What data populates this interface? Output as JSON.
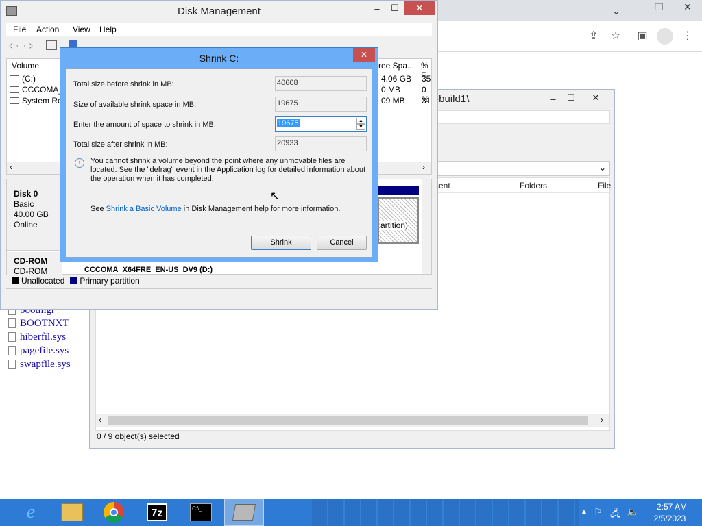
{
  "colors": {
    "accent": "#2d7bd4",
    "dialog_frame": "#6badf6",
    "close_red": "#c75050",
    "primary_partition": "#000080",
    "unallocated": "#000000"
  },
  "chrome": {
    "minimize": "⌄",
    "tab_caret": "⌄",
    "win_min": "–",
    "win_max": "❐",
    "win_close": "✕"
  },
  "explorer": {
    "path": "t-build1\\",
    "columns": [
      "ment",
      "Folders",
      "File"
    ],
    "status": "0 / 9 object(s) selected",
    "files": [
      "bootmgr",
      "BOOTNXT",
      "hiberfil.sys",
      "pagefile.sys",
      "swapfile.sys"
    ]
  },
  "disk_mgmt": {
    "title": "Disk Management",
    "menu": [
      "File",
      "Action",
      "View",
      "Help"
    ],
    "columns": {
      "volume": "Volume",
      "free": "ree Spa...",
      "pct": "% F"
    },
    "volumes": [
      {
        "name": "(C:)",
        "free": "4.06 GB",
        "pct": "35"
      },
      {
        "name": "CCCOMA_",
        "free": "0 MB",
        "pct": "0 %"
      },
      {
        "name": "System Res",
        "free": "09 MB",
        "pct": "31"
      }
    ],
    "disk0": {
      "name": "Disk 0",
      "type": "Basic",
      "size": "40.00 GB",
      "status": "Online"
    },
    "partition_text": "artition)",
    "cdrom": {
      "name": "CD-ROM",
      "type": "CD-ROM",
      "volume": "CCCOMA_X64FRE_EN-US_DV9 (D:)"
    },
    "legend": {
      "unallocated": "Unallocated",
      "primary": "Primary partition"
    }
  },
  "dialog": {
    "title": "Shrink C:",
    "rows": [
      {
        "label": "Total size before shrink in MB:",
        "value": "40608"
      },
      {
        "label": "Size of available shrink space in MB:",
        "value": "19675"
      },
      {
        "label": "Enter the amount of space to shrink in MB:",
        "value": "19675"
      },
      {
        "label": "Total size after shrink in MB:",
        "value": "20933"
      }
    ],
    "info": "You cannot shrink a volume beyond the point where any unmovable files are located. See the \"defrag\" event in the Application log for detailed information about the operation when it has completed.",
    "see_prefix": "See ",
    "see_link": "Shrink a Basic Volume",
    "see_suffix": " in Disk Management help for more information.",
    "shrink": "Shrink",
    "cancel": "Cancel"
  },
  "taskbar": {
    "time": "2:57 AM",
    "date": "2/5/2023",
    "apps": [
      "ie-icon",
      "file-explorer-icon",
      "chrome-icon",
      "7zip-icon",
      "cmd-icon",
      "disk-mgmt-icon"
    ],
    "seven_zip": "7z",
    "cmd": "C:\\_"
  }
}
